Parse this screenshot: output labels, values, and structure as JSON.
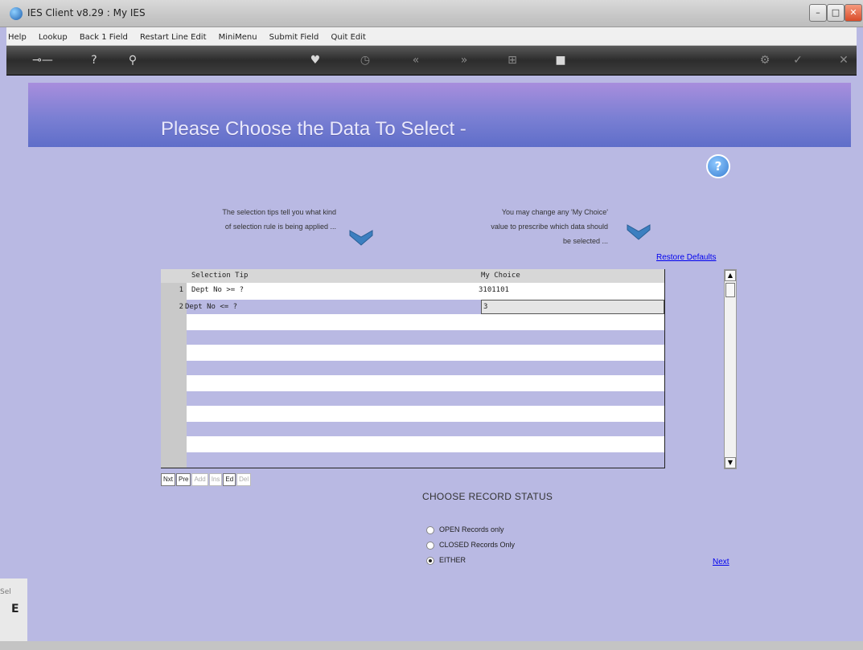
{
  "window": {
    "title": "IES Client v8.29 : My IES"
  },
  "menu": [
    "Help",
    "Lookup",
    "Back 1 Field",
    "Restart Line Edit",
    "MiniMenu",
    "Submit Field",
    "Quit Edit"
  ],
  "header": {
    "title": "Please Choose the Data To Select -"
  },
  "tips": {
    "left": [
      "The selection tips tell you what kind",
      "of selection rule is being applied ..."
    ],
    "right": [
      "You may change any 'My Choice'",
      "value to prescribe which data should",
      "be selected ..."
    ]
  },
  "restore_defaults": "Restore Defaults",
  "grid": {
    "headers": {
      "tip": "Selection Tip",
      "choice": "My Choice"
    },
    "rows": [
      {
        "num": "1",
        "tip": "Dept No >= ?",
        "choice": "3101101"
      },
      {
        "num": "2",
        "tip": "Dept No <= ?",
        "choice": "3"
      }
    ]
  },
  "nav_buttons": [
    "Nxt",
    "Pre",
    "Add",
    "Ins",
    "Ed",
    "Del"
  ],
  "record_status": {
    "title": "CHOOSE RECORD STATUS",
    "options": [
      "OPEN Records only",
      "CLOSED Records Only",
      "EITHER"
    ],
    "selected": "EITHER"
  },
  "next_link": "Next",
  "side": {
    "label": "Sel",
    "letter": "E"
  }
}
